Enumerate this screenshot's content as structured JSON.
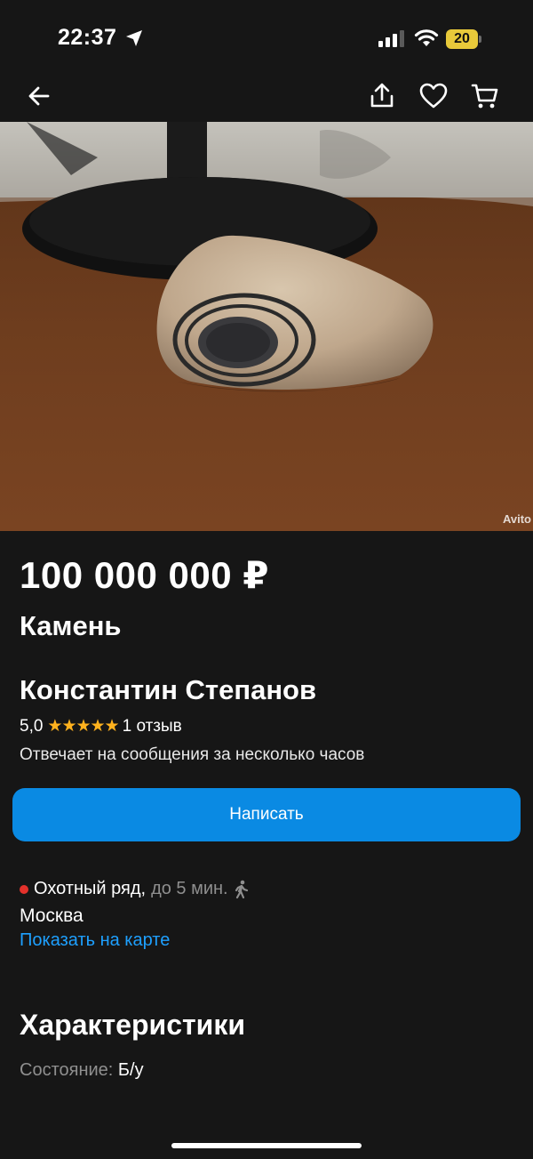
{
  "status_bar": {
    "time": "22:37",
    "battery": "20",
    "battery_color": "#e8c93a"
  },
  "nav": {
    "icons": [
      "back-arrow-icon",
      "share-icon",
      "heart-icon",
      "cart-icon"
    ]
  },
  "listing": {
    "photo_watermark": "Avito",
    "price": "100 000 000 ₽",
    "title": "Камень"
  },
  "seller": {
    "name": "Константин Степанов",
    "rating": "5,0",
    "stars": "★★★★★",
    "stars_value": 5,
    "reviews": "1 отзыв",
    "response_time": "Отвечает на сообщения за несколько часов",
    "write_button": "Написать"
  },
  "location": {
    "metro": "Охотный ряд,",
    "metro_distance": "до 5 мин.",
    "metro_line_color": "#e4312b",
    "city": "Москва",
    "map_link": "Показать на карте"
  },
  "characteristics": {
    "title": "Характеристики",
    "condition_label": "Состояние:",
    "condition_value": "Б/у"
  },
  "colors": {
    "background": "#161616",
    "accent_button": "#0a8ae3",
    "link": "#1ea0ff",
    "star": "#ffb21e"
  }
}
